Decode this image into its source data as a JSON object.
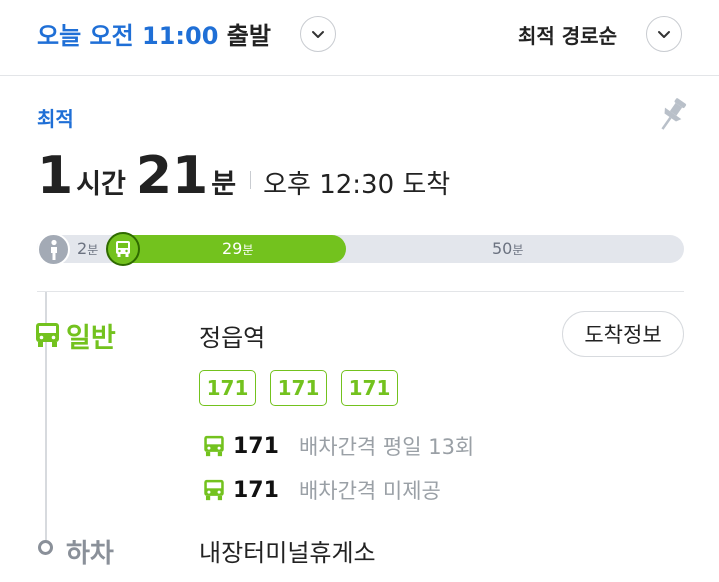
{
  "header": {
    "departure_prefix": "오늘 오전 11:00",
    "departure_suffix": " 출발",
    "sort_label": "최적 경로순"
  },
  "route": {
    "badge": "최적",
    "duration_hours": "1",
    "duration_hours_unit": "시간",
    "duration_minutes": "21",
    "duration_minutes_unit": "분",
    "arrival": "오후 12:30 도착",
    "segments": {
      "walk_value": "2",
      "bus_value": "29",
      "rest_value": "50",
      "unit": "분"
    }
  },
  "leg": {
    "mode_label": "일반",
    "board_stop": "정읍역",
    "arrival_info_button": "도착정보",
    "route_chips": [
      "171",
      "171",
      "171"
    ],
    "routes": [
      {
        "number": "171",
        "info": "배차간격 평일 13회"
      },
      {
        "number": "171",
        "info": "배차간격 미제공"
      }
    ],
    "alight_label": "하차",
    "alight_stop": "내장터미널휴게소"
  },
  "colors": {
    "accent_blue": "#1f6fd6",
    "bus_green": "#73c21e",
    "gray_text": "#9aa0a6"
  },
  "icons": [
    "chevron-down-icon",
    "pin-icon",
    "walk-icon",
    "bus-icon"
  ]
}
